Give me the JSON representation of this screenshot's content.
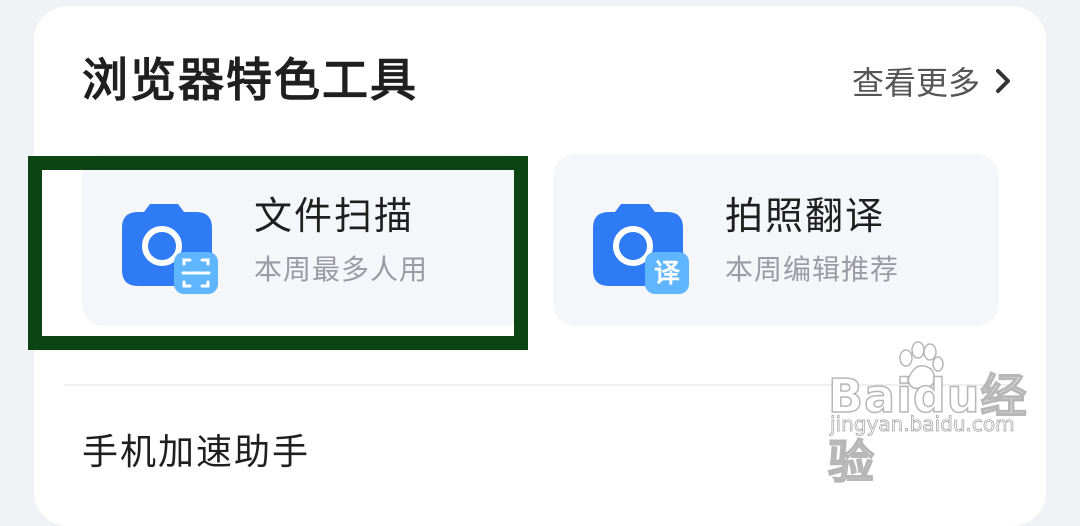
{
  "section": {
    "title": "浏览器特色工具",
    "more_label": "查看更多"
  },
  "tools": [
    {
      "name": "文件扫描",
      "subtitle": "本周最多人用",
      "icon": "camera-scan-icon"
    },
    {
      "name": "拍照翻译",
      "subtitle": "本周编辑推荐",
      "icon": "camera-translate-icon",
      "badge_text": "译"
    }
  ],
  "next_section": {
    "title": "手机加速助手"
  },
  "watermark": {
    "brand": "Baidu经验",
    "url": "jingyan.baidu.com"
  },
  "colors": {
    "highlight_border": "#0c4414",
    "icon_blue": "#2f7bf5",
    "badge_blue": "#5fb6ff"
  }
}
